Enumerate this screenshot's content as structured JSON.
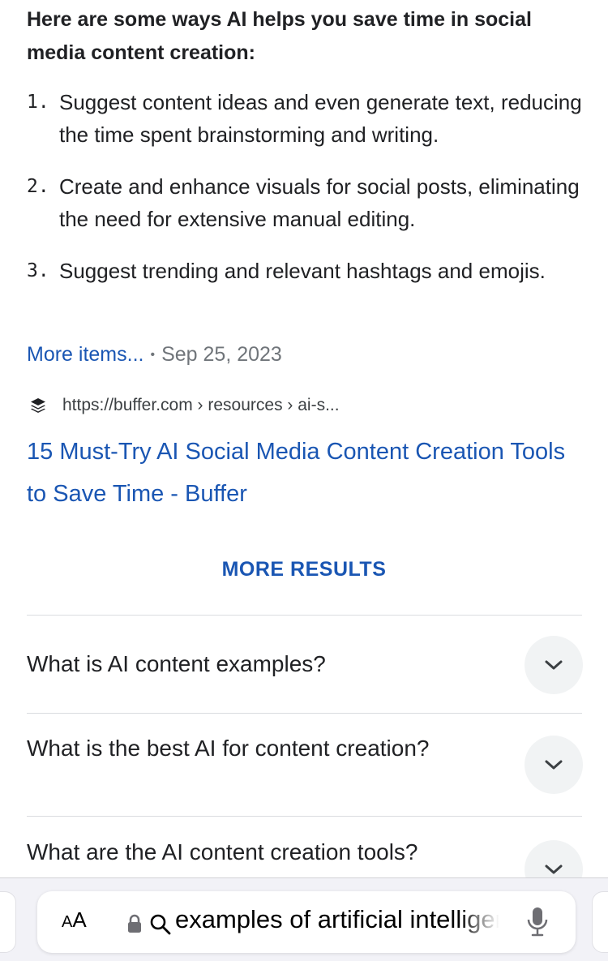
{
  "featured_snippet": {
    "heading": "Here are some ways AI helps you save time in social media content creation:",
    "items": [
      {
        "num": "1.",
        "text": "Suggest content ideas and even generate text, reducing the time spent brainstorming and writing."
      },
      {
        "num": "2.",
        "text": "Create and enhance visuals for social posts, eliminating the need for extensive manual editing."
      },
      {
        "num": "3.",
        "text": "Suggest trending and relevant hashtags and emojis."
      }
    ],
    "more_items_label": "More items...",
    "separator": "•",
    "date": "Sep 25, 2023",
    "source_url": "https://buffer.com › resources › ai-s...",
    "source_icon": "buffer-logo-icon",
    "result_title": "15 Must-Try AI Social Media Content Creation Tools to Save Time - Buffer"
  },
  "more_results_label": "MORE RESULTS",
  "people_also_ask": [
    {
      "question": "What is AI content examples?"
    },
    {
      "question": "What is the best AI for content creation?"
    },
    {
      "question": "What are the AI content creation tools?"
    }
  ],
  "browser_bar": {
    "text_size_label_large": "A",
    "text_size_label_small": "A",
    "address_text": "examples of artificial intelligence",
    "lock_icon": "lock-icon",
    "search_icon": "search-icon",
    "mic_icon": "microphone-icon"
  },
  "colors": {
    "link_blue": "#1a56b3",
    "text_dark": "#202124",
    "meta_gray": "#70757a",
    "chevron_bg": "#f1f3f4"
  }
}
